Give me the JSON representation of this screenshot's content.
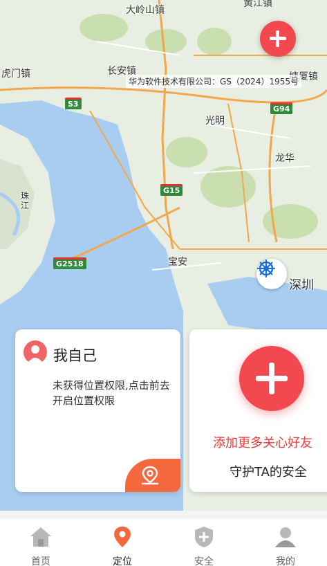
{
  "map": {
    "labels": {
      "dalingshan": "大岭山镇",
      "humen": "虎门镇",
      "changan": "长安镇",
      "guangming": "光明",
      "longhua": "龙华",
      "baoan": "宝安",
      "shenzhen": "深圳",
      "zhujiang": "珠\n江",
      "top_right": "黄江镇",
      "tangxia": "塘厦镇"
    },
    "road_badges": {
      "s3": "S3",
      "g94": "G94",
      "g15": "G15",
      "g2518": "G2518"
    },
    "copyright": "华为软件技术有限公司：GS（2024）1955号",
    "colors": {
      "water": "#a8cdf0",
      "land": "#e8eee1",
      "road_major": "#f4a64a",
      "road_minor": "#ffffff",
      "park": "#c9dfb0"
    }
  },
  "self_card": {
    "name": "我自己",
    "message": "未获得位置权限,点击前去开启位置权限"
  },
  "add_card": {
    "title": "添加更多关心好友",
    "subtitle": "守护TA的安全"
  },
  "tabs": {
    "home": "首页",
    "locate": "定位",
    "safety": "安全",
    "mine": "我的"
  },
  "icons": {
    "add": "plus-icon",
    "compass": "compass-icon",
    "location": "location-pin-icon",
    "home": "home-icon",
    "shield": "shield-icon",
    "person": "person-icon"
  },
  "accent": "#f2484f"
}
